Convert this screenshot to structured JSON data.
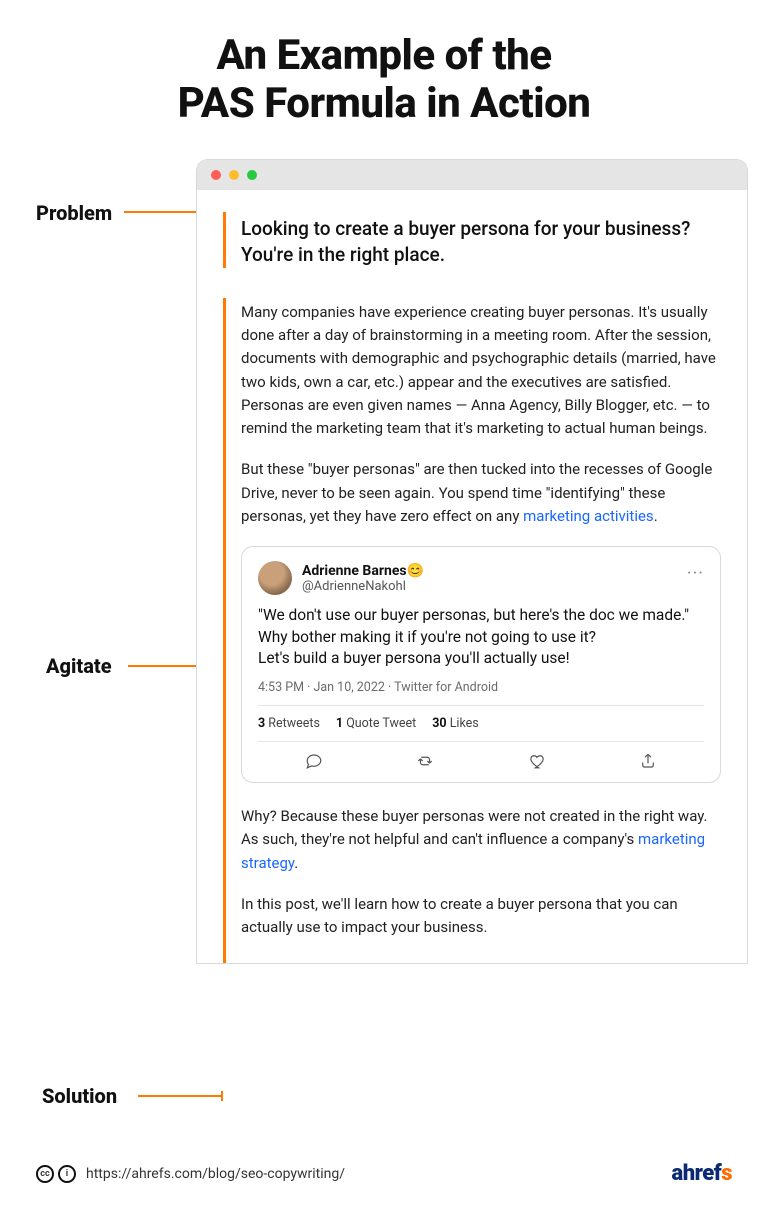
{
  "title": {
    "line1": "An Example of the",
    "line2": "PAS Formula in Action"
  },
  "labels": {
    "problem": "Problem",
    "agitate": "Agitate",
    "solution": "Solution"
  },
  "accent_color": "#ff7a00",
  "link_color": "#1967ff",
  "content": {
    "lead": "Looking to create a buyer persona for your business? You're in the right place.",
    "p1": "Many companies have experience creating buyer personas. It's usually done after a day of brainstorming in a meeting room. After the session, documents with demographic and psychographic details (married, have two kids, own a car, etc.) appear and the executives are satisfied. Personas are even given names — Anna Agency, Billy Blogger, etc. — to remind the marketing team that it's marketing to actual human beings.",
    "p2_a": "But these \"buyer personas\" are then tucked into the recesses of Google Drive, never to be seen again. You spend time \"identifying\" these personas, yet they have zero effect on any ",
    "p2_link": "marketing activities",
    "p2_b": ".",
    "p3_a": "Why? Because these buyer personas were not created in the right way. As such, they're not helpful and can't influence a company's ",
    "p3_link": "marketing strategy",
    "p3_b": ".",
    "p4": "In this post, we'll learn how to create a buyer persona that you can actually use to impact your business."
  },
  "tweet": {
    "name": "Adrienne Barnes",
    "name_emoji": "😊",
    "handle": "@AdrienneNakohl",
    "menu_glyph": "···",
    "text_line1": "\"We don't use our buyer personas, but here's the doc we made.\"",
    "text_line2": "Why bother making it if you're not going to use it?",
    "text_line3": "Let's build a buyer persona you'll actually use!",
    "meta": "4:53 PM · Jan 10, 2022 · Twitter for Android",
    "stats": {
      "retweets_n": "3",
      "retweets_l": "Retweets",
      "quotes_n": "1",
      "quotes_l": "Quote Tweet",
      "likes_n": "30",
      "likes_l": "Likes"
    }
  },
  "footer": {
    "cc1": "cc",
    "cc2": "i",
    "url": "https://ahrefs.com/blog/seo-copywriting/",
    "brand_prefix": "ahref",
    "brand_suffix": "s"
  }
}
